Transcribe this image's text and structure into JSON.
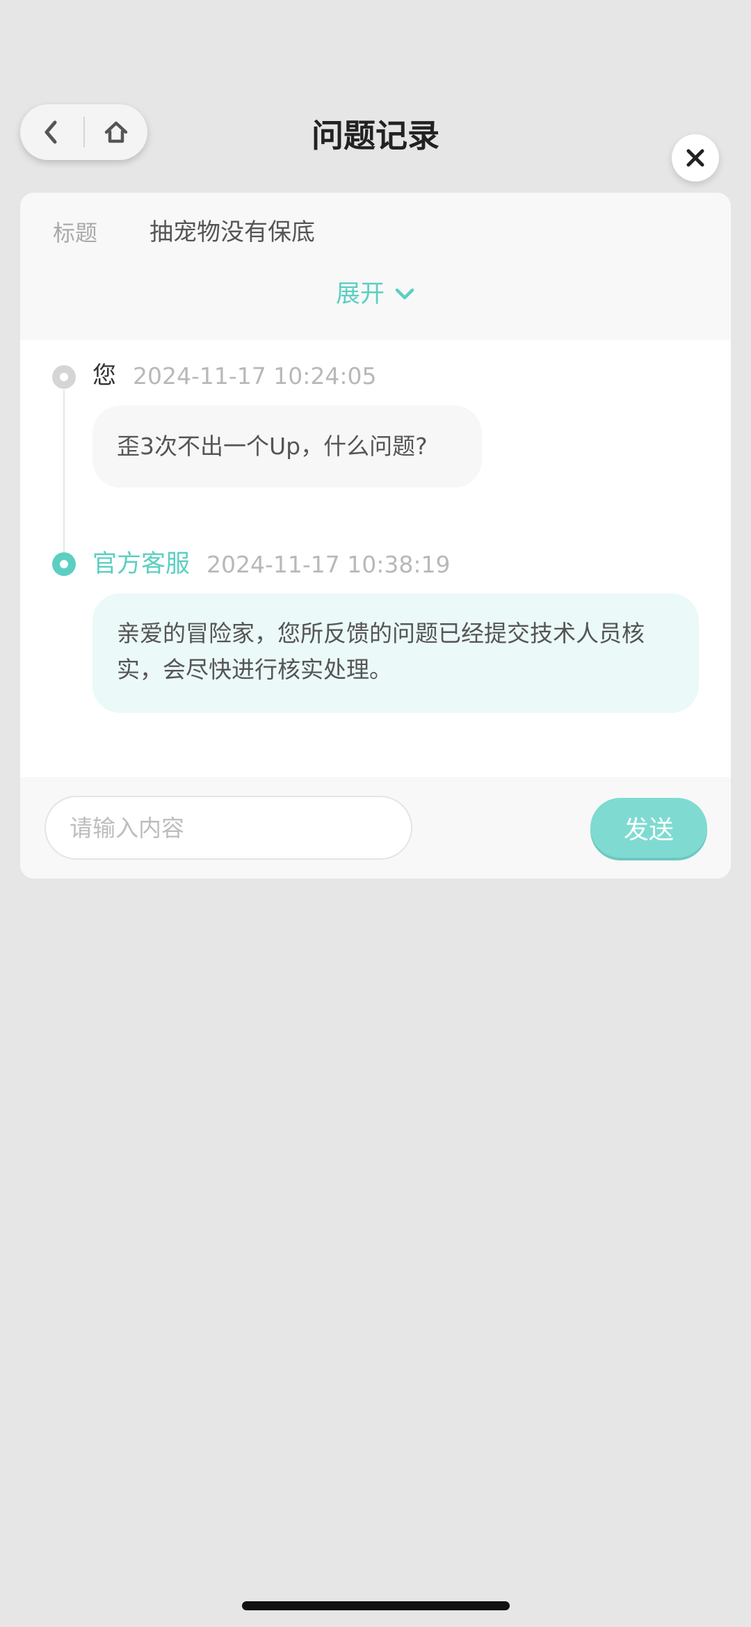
{
  "header": {
    "title": "问题记录"
  },
  "record": {
    "title_label": "标题",
    "title_value": "抽宠物没有保底",
    "expand_label": "展开"
  },
  "messages": [
    {
      "sender": "您",
      "time": "2024-11-17 10:24:05",
      "text": "歪3次不出一个Up，什么问题?"
    },
    {
      "sender": "官方客服",
      "time": "2024-11-17 10:38:19",
      "text": "亲爱的冒险家，您所反馈的问题已经提交技术人员核实，会尽快进行核实处理。"
    }
  ],
  "composer": {
    "placeholder": "请输入内容",
    "value": "",
    "send_label": "发送"
  },
  "colors": {
    "accent": "#5ccfc2",
    "send_button": "#7fdbd2",
    "staff_bubble": "#ebf9f8",
    "background": "#e6e6e6"
  },
  "icons": [
    "back-arrow-icon",
    "home-icon",
    "close-icon",
    "chevron-down-icon"
  ]
}
